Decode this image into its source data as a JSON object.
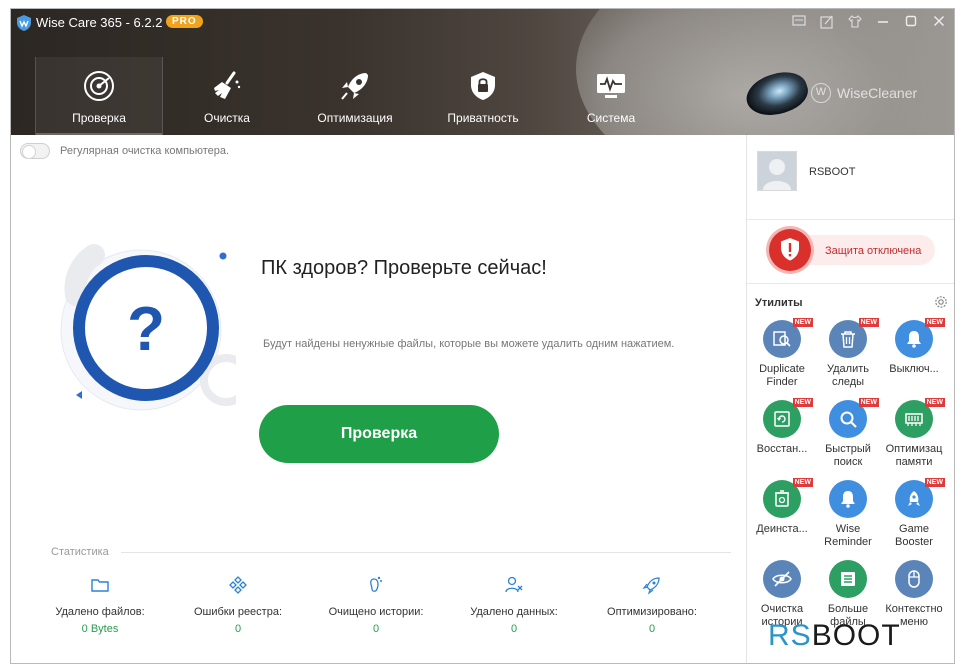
{
  "window": {
    "title": "Wise Care 365 - 6.2.2",
    "badge": "PRO",
    "controls": [
      "feedback-icon",
      "skin-icon",
      "shirt-icon",
      "minimize-icon",
      "maximize-icon",
      "close-icon"
    ]
  },
  "nav": [
    {
      "label": "Проверка",
      "icon": "radar-icon",
      "active": true
    },
    {
      "label": "Очистка",
      "icon": "broom-icon",
      "active": false
    },
    {
      "label": "Оптимизация",
      "icon": "rocket-icon",
      "active": false
    },
    {
      "label": "Приватность",
      "icon": "lock-shield-icon",
      "active": false
    },
    {
      "label": "Система",
      "icon": "monitor-pulse-icon",
      "active": false
    }
  ],
  "brand": "WiseCleaner",
  "main": {
    "toggle_label": "Регулярная очистка компьютера.",
    "headline": "ПК здоров? Проверьте сейчас!",
    "subtext": "Будут найдены ненужные файлы, которые вы можете удалить одним нажатием.",
    "scan_button": "Проверка",
    "stats_title": "Статистика",
    "stats": [
      {
        "label": "Удалено файлов:",
        "value": "0 Bytes",
        "icon": "folder-icon"
      },
      {
        "label": "Ошибки реестра:",
        "value": "0",
        "icon": "registry-icon"
      },
      {
        "label": "Очищено истории:",
        "value": "0",
        "icon": "footprint-icon"
      },
      {
        "label": "Удалено данных:",
        "value": "0",
        "icon": "user-data-icon"
      },
      {
        "label": "Оптимизировано:",
        "value": "0",
        "icon": "rocket-small-icon"
      }
    ]
  },
  "sidebar": {
    "username": "RSBOOT",
    "protection_status": "Защита отключена",
    "utilities_title": "Утилиты",
    "tools": [
      {
        "label": "Duplicate\nFinder",
        "new": true,
        "color": "#5b85b8"
      },
      {
        "label": "Удалить\nследы",
        "new": true,
        "color": "#5b85b8"
      },
      {
        "label": "Выключ...",
        "new": true,
        "color": "#3f8ee0"
      },
      {
        "label": "Восстан...",
        "new": true,
        "color": "#2e9f63"
      },
      {
        "label": "Быстрый\nпоиск",
        "new": true,
        "color": "#3f8ee0"
      },
      {
        "label": "Оптимизац\nпамяти",
        "new": true,
        "color": "#2e9f63"
      },
      {
        "label": "Деинста...",
        "new": true,
        "color": "#2e9f63"
      },
      {
        "label": "Wise\nReminder",
        "new": false,
        "color": "#3f8ee0"
      },
      {
        "label": "Game\nBooster",
        "new": true,
        "color": "#3f8ee0"
      },
      {
        "label": "Очистка\nистории",
        "new": false,
        "color": "#5b85b8"
      },
      {
        "label": "Больше\nфайлы",
        "new": false,
        "color": "#2e9f63"
      },
      {
        "label": "Контекстно\nменю",
        "new": false,
        "color": "#5b85b8"
      }
    ],
    "new_badge": "NEW"
  },
  "watermark": {
    "part1": "RS",
    "part2": "BOOT"
  }
}
